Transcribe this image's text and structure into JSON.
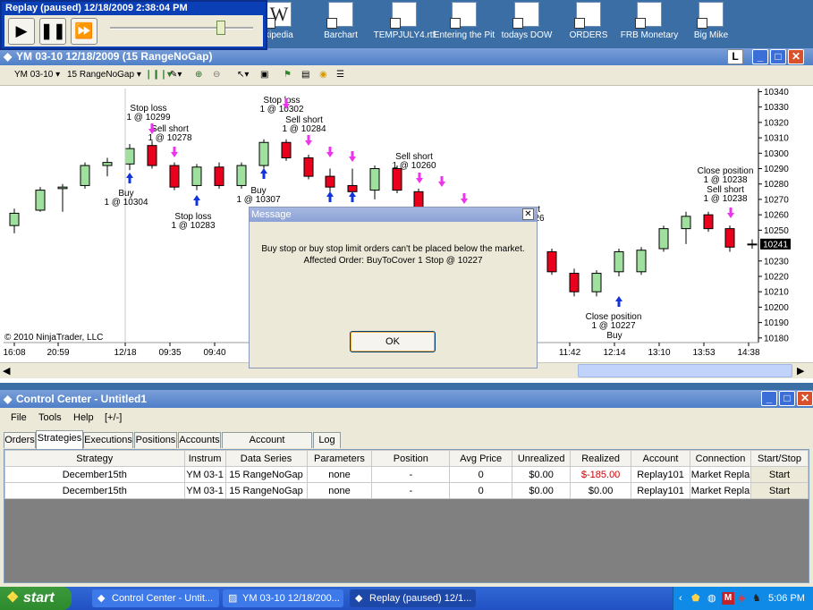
{
  "desktop": {
    "icons": [
      {
        "label": "Wikipedia",
        "visible_label": "kipedia"
      },
      {
        "label": "Barchart"
      },
      {
        "label": "TEMPJULY4.rtf"
      },
      {
        "label": "Entering the Pit"
      },
      {
        "label": "todays DOW"
      },
      {
        "label": "ORDERS"
      },
      {
        "label": "FRB Monetary"
      },
      {
        "label": "Big Mike"
      }
    ]
  },
  "replay_window": {
    "title": "Replay (paused) 12/18/2009 2:38:04 PM",
    "play_icon": "play-icon",
    "pause_icon": "pause-icon",
    "fast_forward_icon": "fast-forward-icon",
    "speed_position": 0.78
  },
  "chart_window": {
    "title": "YM 03-10  12/18/2009 (15 RangeNoGap)",
    "toolbar": {
      "instrument": "YM 03-10",
      "series": "15 RangeNoGap"
    },
    "copyright": "© 2010 NinjaTrader, LLC",
    "current_price_label": "10241"
  },
  "chart_data": {
    "type": "candlestick",
    "x_tick_labels": [
      "16:08",
      "20:59",
      "12/18",
      "09:35",
      "09:40",
      "11:42",
      "12:14",
      "13:10",
      "13:53",
      "14:38"
    ],
    "y_tick_labels": [
      "10340",
      "10330",
      "10320",
      "10310",
      "10300",
      "10290",
      "10280",
      "10270",
      "10260",
      "10250",
      "10230",
      "10220",
      "10210",
      "10200",
      "10190",
      "10180"
    ],
    "ylim": [
      10177,
      10342
    ],
    "current_price": 10241,
    "candles": [
      {
        "o": 10253,
        "c": 10261,
        "h": 10264,
        "l": 10248,
        "dir": "up"
      },
      {
        "o": 10263,
        "c": 10276,
        "h": 10278,
        "l": 10262,
        "dir": "up"
      },
      {
        "o": 10277,
        "c": 10278,
        "h": 10280,
        "l": 10262,
        "dir": "up"
      },
      {
        "o": 10279,
        "c": 10292,
        "h": 10294,
        "l": 10277,
        "dir": "up"
      },
      {
        "o": 10292,
        "c": 10294,
        "h": 10297,
        "l": 10285,
        "dir": "up"
      },
      {
        "o": 10293,
        "c": 10303,
        "h": 10306,
        "l": 10289,
        "dir": "up"
      },
      {
        "o": 10305,
        "c": 10292,
        "h": 10308,
        "l": 10290,
        "dir": "down"
      },
      {
        "o": 10292,
        "c": 10278,
        "h": 10294,
        "l": 10276,
        "dir": "down"
      },
      {
        "o": 10279,
        "c": 10291,
        "h": 10293,
        "l": 10276,
        "dir": "up"
      },
      {
        "o": 10291,
        "c": 10279,
        "h": 10294,
        "l": 10277,
        "dir": "down"
      },
      {
        "o": 10279,
        "c": 10292,
        "h": 10294,
        "l": 10277,
        "dir": "up"
      },
      {
        "o": 10292,
        "c": 10307,
        "h": 10309,
        "l": 10290,
        "dir": "up"
      },
      {
        "o": 10307,
        "c": 10297,
        "h": 10309,
        "l": 10295,
        "dir": "down"
      },
      {
        "o": 10297,
        "c": 10285,
        "h": 10299,
        "l": 10283,
        "dir": "down"
      },
      {
        "o": 10285,
        "c": 10278,
        "h": 10290,
        "l": 10270,
        "dir": "down"
      },
      {
        "o": 10279,
        "c": 10275,
        "h": 10290,
        "l": 10270,
        "dir": "down"
      },
      {
        "o": 10276,
        "c": 10290,
        "h": 10292,
        "l": 10270,
        "dir": "up"
      },
      {
        "o": 10290,
        "c": 10276,
        "h": 10292,
        "l": 10274,
        "dir": "down"
      },
      {
        "o": 10275,
        "c": 10262,
        "h": 10277,
        "l": 10260,
        "dir": "down"
      },
      {
        "o": 10236,
        "c": 10223,
        "h": 10238,
        "l": 10221,
        "dir": "down"
      },
      {
        "o": 10222,
        "c": 10210,
        "h": 10225,
        "l": 10207,
        "dir": "down"
      },
      {
        "o": 10210,
        "c": 10222,
        "h": 10224,
        "l": 10207,
        "dir": "up"
      },
      {
        "o": 10223,
        "c": 10236,
        "h": 10238,
        "l": 10220,
        "dir": "up"
      },
      {
        "o": 10223,
        "c": 10237,
        "h": 10239,
        "l": 10221,
        "dir": "up"
      },
      {
        "o": 10238,
        "c": 10251,
        "h": 10253,
        "l": 10236,
        "dir": "up"
      },
      {
        "o": 10251,
        "c": 10259,
        "h": 10262,
        "l": 10241,
        "dir": "up"
      },
      {
        "o": 10260,
        "c": 10251,
        "h": 10262,
        "l": 10249,
        "dir": "down"
      },
      {
        "o": 10251,
        "c": 10239,
        "h": 10253,
        "l": 10236,
        "dir": "down"
      },
      {
        "o": 10241,
        "c": 10241,
        "h": 10244,
        "l": 10238,
        "dir": "flat"
      }
    ],
    "annotations": [
      "Stop loss",
      "1 @ 10299",
      "Sell short",
      "1 @ 10278",
      "Buy",
      "1 @ 10304",
      "Stop loss",
      "1 @ 10283",
      "Stop loss",
      "1 @ 10302",
      "Sell short",
      "1 @ 10284",
      "Buy",
      "1 @ 10307",
      "Sell short",
      "1 @ 10260",
      "rt",
      "26",
      "Close position",
      "1 @ 10227",
      "Buy",
      "Close position",
      "1 @ 10238",
      "Sell short",
      "1 @ 10238"
    ]
  },
  "dialog": {
    "title": "Message",
    "line1": "Buy stop or buy stop limit orders can't be placed below the market.",
    "line2": "Affected Order: BuyToCover 1 Stop @ 10227",
    "ok_label": "OK"
  },
  "control_center": {
    "title": "Control Center - Untitled1",
    "menu": [
      "File",
      "Tools",
      "Help",
      "[+/-]"
    ],
    "tabs": [
      "Orders",
      "Strategies",
      "Executions",
      "Positions",
      "Accounts",
      "Account Performance",
      "Log"
    ],
    "active_tab": "Strategies",
    "columns": [
      "Strategy",
      "Instrum",
      "Data Series",
      "Parameters",
      "Position",
      "Avg Price",
      "Unrealized",
      "Realized",
      "Account",
      "Connection",
      "Start/Stop"
    ],
    "rows": [
      [
        "December15th",
        "YM 03-1",
        "15 RangeNoGap",
        "none",
        "-",
        "0",
        "$0.00",
        "$-185.00",
        "Replay101",
        "Market Repla",
        "Start"
      ],
      [
        "December15th",
        "YM 03-1",
        "15 RangeNoGap",
        "none",
        "-",
        "0",
        "$0.00",
        "$0.00",
        "Replay101",
        "Market Repla",
        "Start"
      ]
    ],
    "negative_color": "#cc0000"
  },
  "taskbar": {
    "start_label": "start",
    "tasks": [
      "Control Center - Untit...",
      "YM 03-10  12/18/200...",
      "Replay (paused) 12/1..."
    ],
    "clock": "5:06 PM"
  }
}
